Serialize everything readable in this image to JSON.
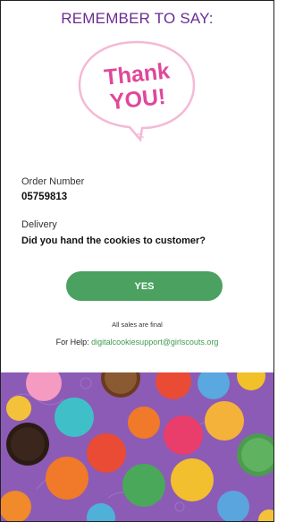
{
  "header": {
    "title": "REMEMBER TO SAY:"
  },
  "bubble": {
    "line1": "Thank",
    "line2": "YOU!"
  },
  "order": {
    "label": "Order Number",
    "value": "05759813"
  },
  "delivery": {
    "label": "Delivery",
    "question": "Did you hand the cookies to customer?"
  },
  "actions": {
    "yes_label": "YES"
  },
  "footer": {
    "final_note": "All sales are final",
    "help_prefix": "For Help:",
    "help_email": "digitalcookiesupport@girlscouts.org"
  },
  "colors": {
    "accent_purple": "#6b2c91",
    "button_green": "#4aa160",
    "link_green": "#3f9a4f",
    "pink": "#e0489b"
  }
}
